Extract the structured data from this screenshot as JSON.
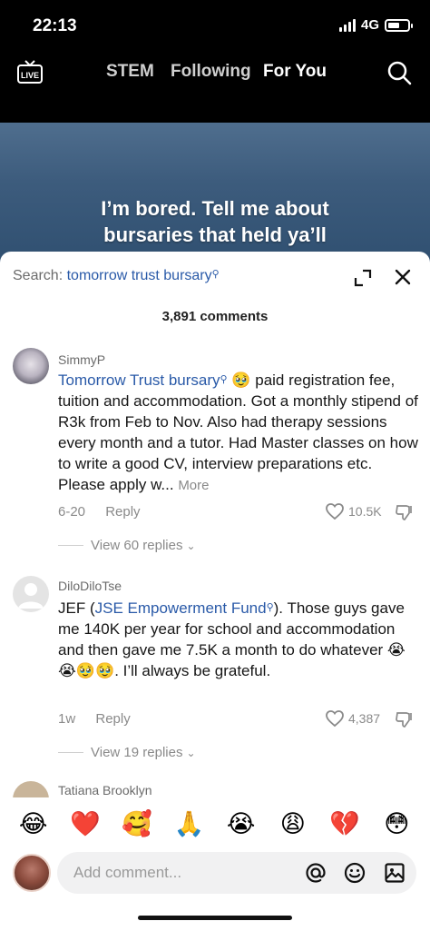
{
  "status_bar": {
    "time": "22:13",
    "network": "4G"
  },
  "nav": {
    "live_label": "LIVE",
    "tabs": [
      "STEM",
      "Following",
      "For You"
    ],
    "active_tab": "For You"
  },
  "video": {
    "caption_lines": [
      "I’m bored. Tell me about",
      "bursaries that held ya’ll"
    ]
  },
  "comments_sheet": {
    "search_prefix": "Search:",
    "search_term": "tomorrow trust bursary",
    "count_label": "3,891 comments",
    "comments": [
      {
        "username": "SimmyP",
        "link_text": "Tomorrow Trust bursary",
        "emoji": "🥹",
        "text": " paid registration fee, tuition and accommodation. Got a monthly stipend of R3k from Feb to Nov. Also had therapy sessions every month and a tutor. Had Master classes on how to write a good CV, interview preparations etc. Please apply w...",
        "more_label": "More",
        "date": "6-20",
        "reply_label": "Reply",
        "likes": "10.5K",
        "view_replies": "View 60 replies"
      },
      {
        "username": "DiloDiloTse",
        "prefix_text": "JEF (",
        "link_text": "JSE Empowerment Fund",
        "text_after_link": "). Those guys gave me 140K per year for school and accommodation and then gave me 7.5K a month to do whatever ",
        "emojis": "😭😭🥹🥹",
        "text_end": ". I’ll always be grateful.",
        "date": "1w",
        "reply_label": "Reply",
        "likes": "4,387",
        "view_replies": "View 19 replies"
      }
    ],
    "partial_username": "Tatiana Brooklyn"
  },
  "emoji_bar": [
    "😂",
    "❤️",
    "🥰",
    "🙏",
    "😭",
    "😩",
    "💔",
    "😳"
  ],
  "input": {
    "placeholder": "Add comment..."
  }
}
